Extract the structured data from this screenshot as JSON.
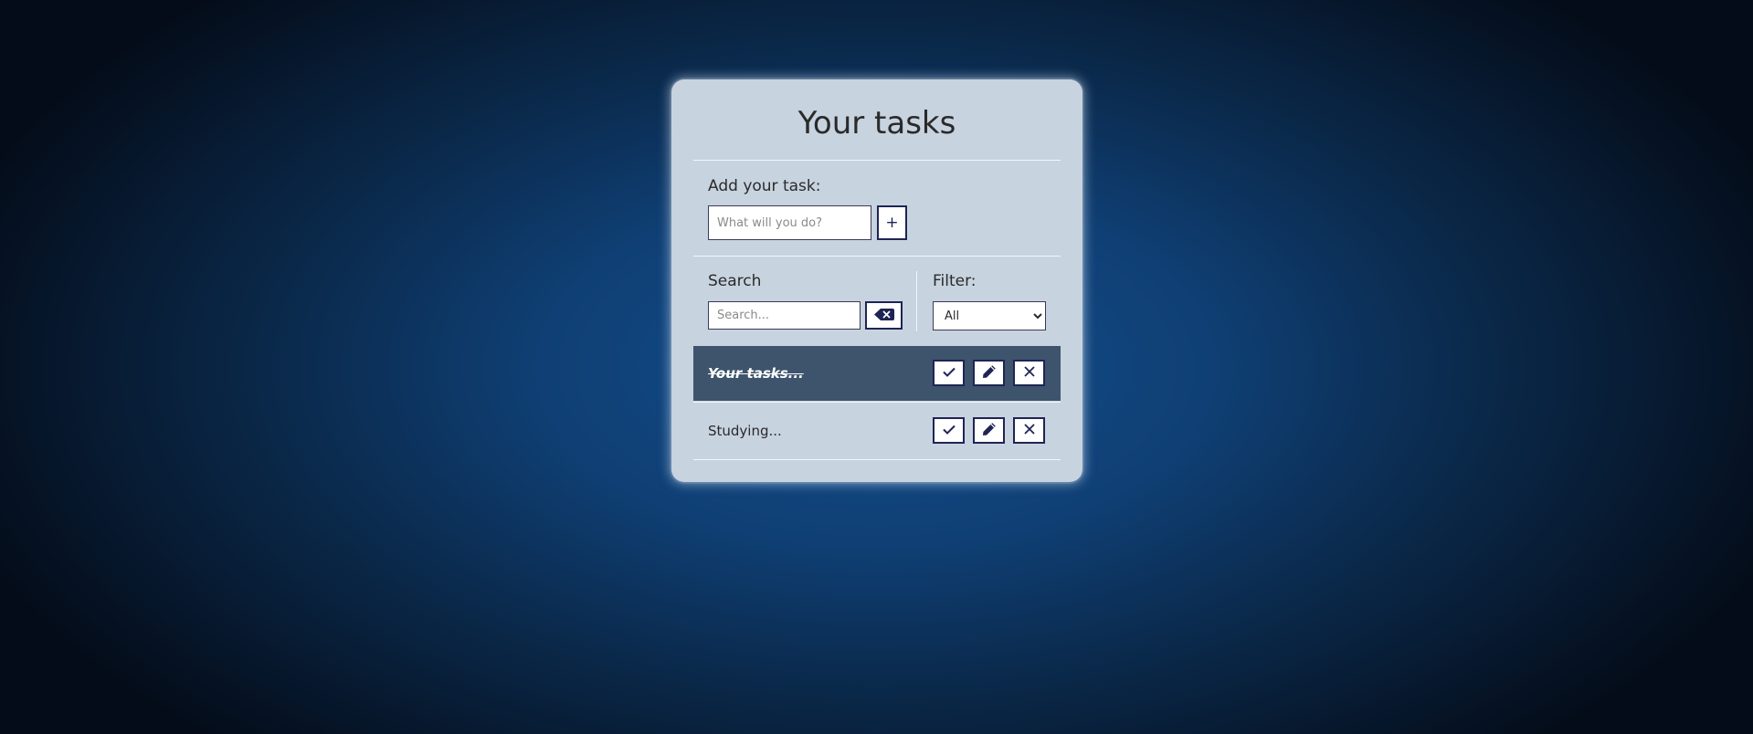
{
  "app": {
    "title": "Your tasks"
  },
  "add": {
    "label": "Add your task:",
    "input_placeholder": "What will you do?",
    "input_value": "",
    "add_button_label": "+"
  },
  "search": {
    "label": "Search",
    "input_placeholder": "Search...",
    "input_value": "",
    "clear_icon": "backspace-icon"
  },
  "filter": {
    "label": "Filter:",
    "selected": "All"
  },
  "tasks": [
    {
      "text": "Your tasks...",
      "completed": true
    },
    {
      "text": "Studying...",
      "completed": false
    }
  ],
  "task_actions": {
    "complete_icon": "check-icon",
    "edit_icon": "pencil-icon",
    "delete_icon": "close-icon"
  },
  "colors": {
    "card_bg": "#c8d3e0",
    "completed_row_bg": "#3d546c",
    "button_border": "#1f2455",
    "background_center": "#134e8c",
    "background_edge": "#040c19"
  }
}
